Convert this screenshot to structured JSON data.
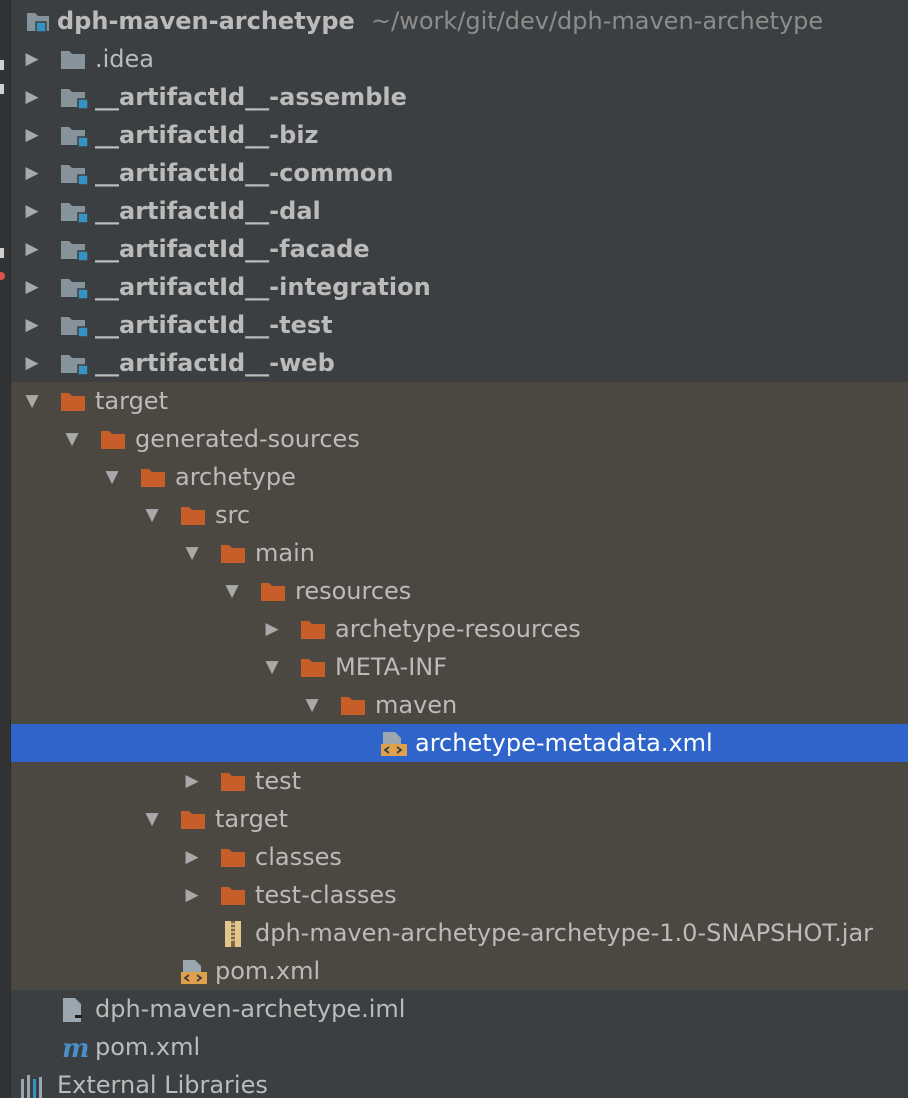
{
  "project": {
    "name": "dph-maven-archetype",
    "path": "~/work/git/dev/dph-maven-archetype"
  },
  "colors": {
    "panel_background": "#3c3f41",
    "excluded_background": "#4b4741",
    "selection_background": "#2f65ca",
    "module_folder": "#87939a",
    "module_badge": "#3592c4",
    "excluded_folder": "#c75d28",
    "text": "#bbbbbb"
  },
  "tree": [
    {
      "label": ".idea",
      "depth": 0,
      "arrow": "collapsed",
      "icon": "folder-icon",
      "bold": false,
      "excluded": false
    },
    {
      "label": "__artifactId__-assemble",
      "depth": 0,
      "arrow": "collapsed",
      "icon": "module-folder-icon",
      "bold": true,
      "excluded": false
    },
    {
      "label": "__artifactId__-biz",
      "depth": 0,
      "arrow": "collapsed",
      "icon": "module-folder-icon",
      "bold": true,
      "excluded": false
    },
    {
      "label": "__artifactId__-common",
      "depth": 0,
      "arrow": "collapsed",
      "icon": "module-folder-icon",
      "bold": true,
      "excluded": false
    },
    {
      "label": "__artifactId__-dal",
      "depth": 0,
      "arrow": "collapsed",
      "icon": "module-folder-icon",
      "bold": true,
      "excluded": false
    },
    {
      "label": "__artifactId__-facade",
      "depth": 0,
      "arrow": "collapsed",
      "icon": "module-folder-icon",
      "bold": true,
      "excluded": false
    },
    {
      "label": "__artifactId__-integration",
      "depth": 0,
      "arrow": "collapsed",
      "icon": "module-folder-icon",
      "bold": true,
      "excluded": false
    },
    {
      "label": "__artifactId__-test",
      "depth": 0,
      "arrow": "collapsed",
      "icon": "module-folder-icon",
      "bold": true,
      "excluded": false
    },
    {
      "label": "__artifactId__-web",
      "depth": 0,
      "arrow": "collapsed",
      "icon": "module-folder-icon",
      "bold": true,
      "excluded": false
    },
    {
      "label": "target",
      "depth": 0,
      "arrow": "expanded",
      "icon": "excluded-folder-icon",
      "bold": false,
      "excluded": true
    },
    {
      "label": "generated-sources",
      "depth": 1,
      "arrow": "expanded",
      "icon": "excluded-folder-icon",
      "bold": false,
      "excluded": true
    },
    {
      "label": "archetype",
      "depth": 2,
      "arrow": "expanded",
      "icon": "excluded-folder-icon",
      "bold": false,
      "excluded": true
    },
    {
      "label": "src",
      "depth": 3,
      "arrow": "expanded",
      "icon": "excluded-folder-icon",
      "bold": false,
      "excluded": true
    },
    {
      "label": "main",
      "depth": 4,
      "arrow": "expanded",
      "icon": "excluded-folder-icon",
      "bold": false,
      "excluded": true
    },
    {
      "label": "resources",
      "depth": 5,
      "arrow": "expanded",
      "icon": "excluded-folder-icon",
      "bold": false,
      "excluded": true
    },
    {
      "label": "archetype-resources",
      "depth": 6,
      "arrow": "collapsed",
      "icon": "excluded-folder-icon",
      "bold": false,
      "excluded": true
    },
    {
      "label": "META-INF",
      "depth": 6,
      "arrow": "expanded",
      "icon": "excluded-folder-icon",
      "bold": false,
      "excluded": true
    },
    {
      "label": "maven",
      "depth": 7,
      "arrow": "expanded",
      "icon": "excluded-folder-icon",
      "bold": false,
      "excluded": true
    },
    {
      "label": "archetype-metadata.xml",
      "depth": 8,
      "arrow": "none",
      "icon": "xml-file-icon",
      "bold": false,
      "excluded": true,
      "selected": true
    },
    {
      "label": "test",
      "depth": 4,
      "arrow": "collapsed",
      "icon": "excluded-folder-icon",
      "bold": false,
      "excluded": true
    },
    {
      "label": "target",
      "depth": 3,
      "arrow": "expanded",
      "icon": "excluded-folder-icon",
      "bold": false,
      "excluded": true
    },
    {
      "label": "classes",
      "depth": 4,
      "arrow": "collapsed",
      "icon": "excluded-folder-icon",
      "bold": false,
      "excluded": true
    },
    {
      "label": "test-classes",
      "depth": 4,
      "arrow": "collapsed",
      "icon": "excluded-folder-icon",
      "bold": false,
      "excluded": true
    },
    {
      "label": "dph-maven-archetype-archetype-1.0-SNAPSHOT.jar",
      "depth": 4,
      "arrow": "none",
      "icon": "jar-file-icon",
      "bold": false,
      "excluded": true
    },
    {
      "label": "pom.xml",
      "depth": 3,
      "arrow": "none",
      "icon": "xml-file-icon",
      "bold": false,
      "excluded": true
    },
    {
      "label": "dph-maven-archetype.iml",
      "depth": 0,
      "arrow": "none",
      "icon": "iml-file-icon",
      "bold": false,
      "excluded": false
    },
    {
      "label": "pom.xml",
      "depth": 0,
      "arrow": "none",
      "icon": "maven-pom-icon",
      "bold": false,
      "excluded": false
    },
    {
      "label": "External Libraries",
      "depth": -1,
      "arrow": "none",
      "icon": "external-libraries-icon",
      "bold": false,
      "excluded": false
    }
  ]
}
